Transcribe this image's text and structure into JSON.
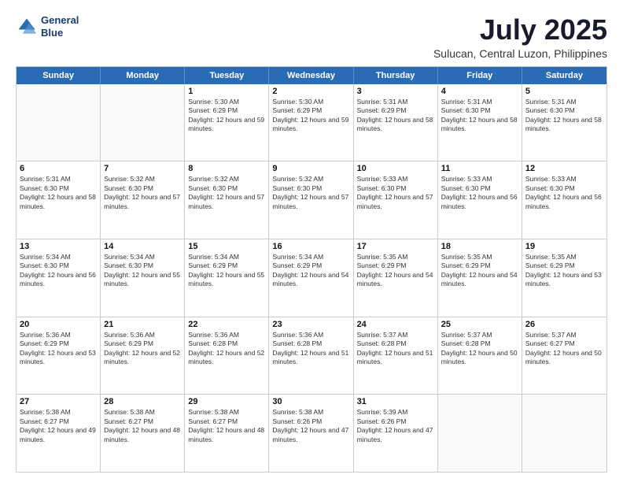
{
  "header": {
    "logo_line1": "General",
    "logo_line2": "Blue",
    "main_title": "July 2025",
    "subtitle": "Sulucan, Central Luzon, Philippines"
  },
  "weekdays": [
    "Sunday",
    "Monday",
    "Tuesday",
    "Wednesday",
    "Thursday",
    "Friday",
    "Saturday"
  ],
  "weeks": [
    [
      {
        "day": "",
        "info": ""
      },
      {
        "day": "",
        "info": ""
      },
      {
        "day": "1",
        "info": "Sunrise: 5:30 AM\nSunset: 6:29 PM\nDaylight: 12 hours and 59 minutes."
      },
      {
        "day": "2",
        "info": "Sunrise: 5:30 AM\nSunset: 6:29 PM\nDaylight: 12 hours and 59 minutes."
      },
      {
        "day": "3",
        "info": "Sunrise: 5:31 AM\nSunset: 6:29 PM\nDaylight: 12 hours and 58 minutes."
      },
      {
        "day": "4",
        "info": "Sunrise: 5:31 AM\nSunset: 6:30 PM\nDaylight: 12 hours and 58 minutes."
      },
      {
        "day": "5",
        "info": "Sunrise: 5:31 AM\nSunset: 6:30 PM\nDaylight: 12 hours and 58 minutes."
      }
    ],
    [
      {
        "day": "6",
        "info": "Sunrise: 5:31 AM\nSunset: 6:30 PM\nDaylight: 12 hours and 58 minutes."
      },
      {
        "day": "7",
        "info": "Sunrise: 5:32 AM\nSunset: 6:30 PM\nDaylight: 12 hours and 57 minutes."
      },
      {
        "day": "8",
        "info": "Sunrise: 5:32 AM\nSunset: 6:30 PM\nDaylight: 12 hours and 57 minutes."
      },
      {
        "day": "9",
        "info": "Sunrise: 5:32 AM\nSunset: 6:30 PM\nDaylight: 12 hours and 57 minutes."
      },
      {
        "day": "10",
        "info": "Sunrise: 5:33 AM\nSunset: 6:30 PM\nDaylight: 12 hours and 57 minutes."
      },
      {
        "day": "11",
        "info": "Sunrise: 5:33 AM\nSunset: 6:30 PM\nDaylight: 12 hours and 56 minutes."
      },
      {
        "day": "12",
        "info": "Sunrise: 5:33 AM\nSunset: 6:30 PM\nDaylight: 12 hours and 56 minutes."
      }
    ],
    [
      {
        "day": "13",
        "info": "Sunrise: 5:34 AM\nSunset: 6:30 PM\nDaylight: 12 hours and 56 minutes."
      },
      {
        "day": "14",
        "info": "Sunrise: 5:34 AM\nSunset: 6:30 PM\nDaylight: 12 hours and 55 minutes."
      },
      {
        "day": "15",
        "info": "Sunrise: 5:34 AM\nSunset: 6:29 PM\nDaylight: 12 hours and 55 minutes."
      },
      {
        "day": "16",
        "info": "Sunrise: 5:34 AM\nSunset: 6:29 PM\nDaylight: 12 hours and 54 minutes."
      },
      {
        "day": "17",
        "info": "Sunrise: 5:35 AM\nSunset: 6:29 PM\nDaylight: 12 hours and 54 minutes."
      },
      {
        "day": "18",
        "info": "Sunrise: 5:35 AM\nSunset: 6:29 PM\nDaylight: 12 hours and 54 minutes."
      },
      {
        "day": "19",
        "info": "Sunrise: 5:35 AM\nSunset: 6:29 PM\nDaylight: 12 hours and 53 minutes."
      }
    ],
    [
      {
        "day": "20",
        "info": "Sunrise: 5:36 AM\nSunset: 6:29 PM\nDaylight: 12 hours and 53 minutes."
      },
      {
        "day": "21",
        "info": "Sunrise: 5:36 AM\nSunset: 6:29 PM\nDaylight: 12 hours and 52 minutes."
      },
      {
        "day": "22",
        "info": "Sunrise: 5:36 AM\nSunset: 6:28 PM\nDaylight: 12 hours and 52 minutes."
      },
      {
        "day": "23",
        "info": "Sunrise: 5:36 AM\nSunset: 6:28 PM\nDaylight: 12 hours and 51 minutes."
      },
      {
        "day": "24",
        "info": "Sunrise: 5:37 AM\nSunset: 6:28 PM\nDaylight: 12 hours and 51 minutes."
      },
      {
        "day": "25",
        "info": "Sunrise: 5:37 AM\nSunset: 6:28 PM\nDaylight: 12 hours and 50 minutes."
      },
      {
        "day": "26",
        "info": "Sunrise: 5:37 AM\nSunset: 6:27 PM\nDaylight: 12 hours and 50 minutes."
      }
    ],
    [
      {
        "day": "27",
        "info": "Sunrise: 5:38 AM\nSunset: 6:27 PM\nDaylight: 12 hours and 49 minutes."
      },
      {
        "day": "28",
        "info": "Sunrise: 5:38 AM\nSunset: 6:27 PM\nDaylight: 12 hours and 48 minutes."
      },
      {
        "day": "29",
        "info": "Sunrise: 5:38 AM\nSunset: 6:27 PM\nDaylight: 12 hours and 48 minutes."
      },
      {
        "day": "30",
        "info": "Sunrise: 5:38 AM\nSunset: 6:26 PM\nDaylight: 12 hours and 47 minutes."
      },
      {
        "day": "31",
        "info": "Sunrise: 5:39 AM\nSunset: 6:26 PM\nDaylight: 12 hours and 47 minutes."
      },
      {
        "day": "",
        "info": ""
      },
      {
        "day": "",
        "info": ""
      }
    ]
  ]
}
